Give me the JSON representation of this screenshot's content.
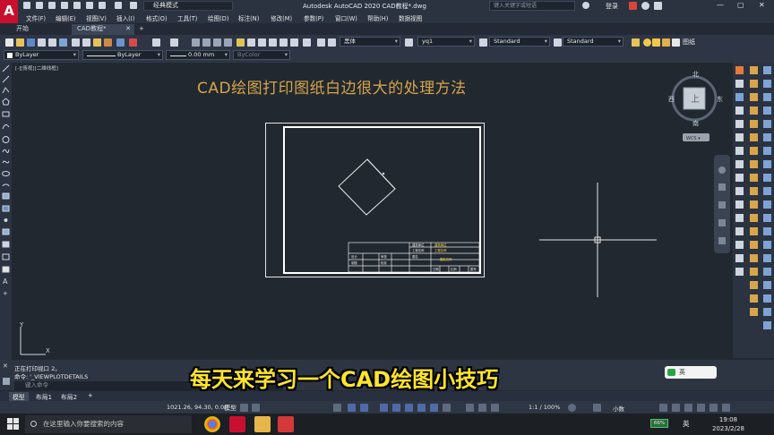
{
  "app": {
    "logo": "A",
    "workspace": "经典模式",
    "title": "Autodesk AutoCAD 2020    CAD教程*.dwg",
    "search_placeholder": "键入关键字或短语",
    "login": "登录",
    "min": "—",
    "max": "▢",
    "close": "✕"
  },
  "menu": [
    "文件(F)",
    "编辑(E)",
    "视图(V)",
    "插入(I)",
    "格式(O)",
    "工具(T)",
    "绘图(D)",
    "标注(N)",
    "修改(M)",
    "参数(P)",
    "窗口(W)",
    "帮助(H)",
    "数据视图"
  ],
  "tabs": {
    "start": "开始",
    "doc": "CAD教程*",
    "close": "✕",
    "add": "+"
  },
  "toolbar": {
    "font": "黑体",
    "text_style": "yq1",
    "dim_style": "Standard",
    "table_style": "Standard",
    "layer": "图纸",
    "prop_layer": "ByLayer",
    "prop_linetype": "ByLayer",
    "prop_lineweight": "0.00 mm",
    "prop_color": "ByColor"
  },
  "canvas": {
    "view_label": "[-][俯视][二维线框]",
    "title_text": "CAD绘图打印图纸白边很大的处理方法",
    "viewcube": {
      "n": "北",
      "s": "南",
      "e": "东",
      "w": "西",
      "face": "上",
      "wcs": "WCS ▾"
    },
    "ucs": {
      "x": "X",
      "y": "Y"
    },
    "title_block": {
      "r1": [
        "建筑单位",
        "建筑单位"
      ],
      "r2": [
        "工程名称",
        "工程名称"
      ],
      "r3": [
        "图名",
        "图纸名称"
      ],
      "r4": [
        "设计",
        "审核"
      ],
      "r5": [
        "制图",
        "批准"
      ],
      "r6": [
        "日期",
        "比例",
        "图号"
      ]
    }
  },
  "command": {
    "history1": "正在打印视口 2。",
    "history2": "命令: '_VIEWPLOTDETAILS",
    "placeholder": "键入命令",
    "x": "✕"
  },
  "subtitle": "每天来学习一个CAD绘图小技巧",
  "ime": "英",
  "layout_tabs": [
    "模型",
    "布局1",
    "布局2",
    "+"
  ],
  "status": {
    "coords": "1021.26, 94.30, 0.00",
    "model": "模型",
    "scale": "1:1 / 100%",
    "units": "小数"
  },
  "taskbar": {
    "search": "在这里输入你要搜索的内容",
    "battery": "66%",
    "lang": "英",
    "time": "19:08",
    "date": "2023/2/28"
  },
  "colors": {
    "background": "#212830",
    "accent_title": "#d6a54a",
    "subtitle": "#ffe52b",
    "autocad_red": "#c8102e"
  }
}
